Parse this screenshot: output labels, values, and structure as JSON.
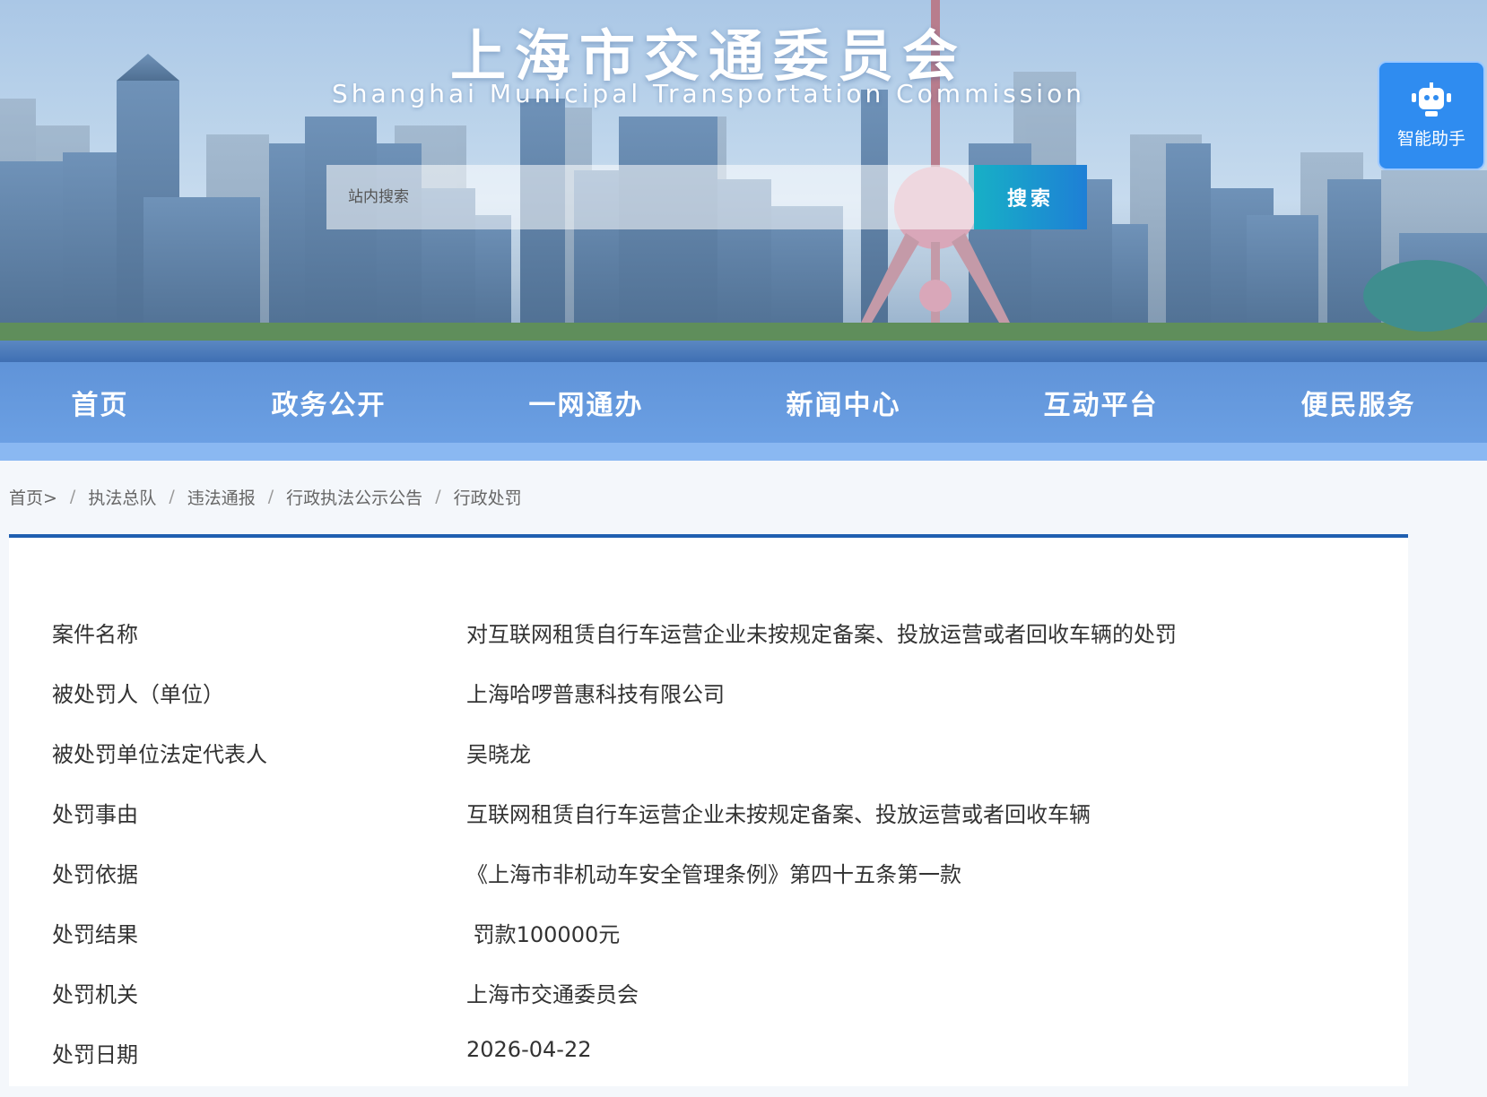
{
  "header": {
    "title": "上海市交通委员会",
    "subtitle": "Shanghai Municipal Transportation Commission"
  },
  "search": {
    "placeholder": "站内搜索",
    "button_label": "搜索"
  },
  "assistant": {
    "label": "智能助手",
    "icon": "robot-icon"
  },
  "nav": {
    "items": [
      "首页",
      "政务公开",
      "一网通办",
      "新闻中心",
      "互动平台",
      "便民服务"
    ]
  },
  "breadcrumb": {
    "items": [
      "首页>",
      "执法总队",
      "违法通报",
      "行政执法公示公告"
    ],
    "current": "行政处罚",
    "separator": "/"
  },
  "case": {
    "rows": [
      {
        "label": "案件名称",
        "value": "对互联网租赁自行车运营企业未按规定备案、投放运营或者回收车辆的处罚"
      },
      {
        "label": "被处罚人（单位）",
        "value": "上海哈啰普惠科技有限公司"
      },
      {
        "label": "被处罚单位法定代表人",
        "value": "吴晓龙"
      },
      {
        "label": "处罚事由",
        "value": "互联网租赁自行车运营企业未按规定备案、投放运营或者回收车辆"
      },
      {
        "label": "处罚依据",
        "value": "《上海市非机动车安全管理条例》第四十五条第一款"
      },
      {
        "label": "处罚结果",
        "value": " 罚款100000元"
      },
      {
        "label": "处罚机关",
        "value": "上海市交通委员会"
      },
      {
        "label": "处罚日期",
        "value": "2026-04-22"
      }
    ]
  },
  "colors": {
    "accent": "#1f5fb0",
    "search_button_start": "#17b0c6",
    "search_button_end": "#1e7fd6",
    "assistant_bg": "#2f8cf0"
  }
}
